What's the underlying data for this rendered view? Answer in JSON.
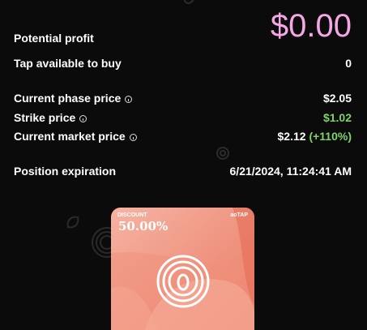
{
  "profit": {
    "label": "Potential profit",
    "value": "$0.00"
  },
  "tap": {
    "label": "Tap available to buy",
    "value": "0"
  },
  "phase_price": {
    "label": "Current phase price",
    "value": "$2.05"
  },
  "strike_price": {
    "label": "Strike price",
    "value": "$1.02"
  },
  "market_price": {
    "label": "Current market price",
    "value": "$2.12",
    "change": "(+110%)"
  },
  "expiration": {
    "label": "Position expiration",
    "value": "6/21/2024, 11:24:41 AM"
  },
  "card": {
    "discount_label": "DISCOUNT",
    "discount_value": "50.00%",
    "token": "aoTAP"
  },
  "colors": {
    "accent_pink": "#f5a6e4",
    "positive_green": "#7fd36b",
    "card_bg": "#f19c87"
  }
}
